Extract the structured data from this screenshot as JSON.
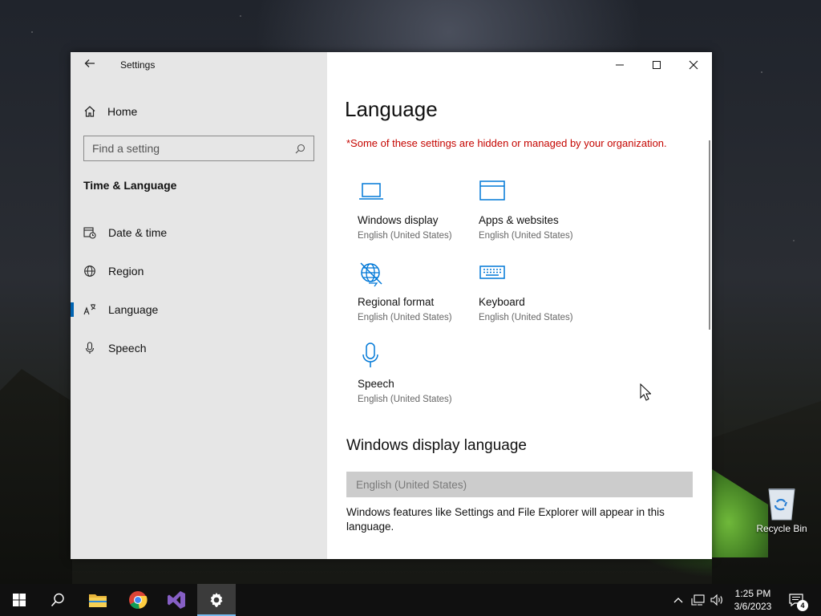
{
  "window": {
    "app_title": "Settings",
    "back_icon": "back-arrow-icon",
    "caption": {
      "minimize": "minimize-icon",
      "maximize": "maximize-icon",
      "close": "close-icon"
    }
  },
  "sidebar": {
    "home_label": "Home",
    "search_placeholder": "Find a setting",
    "section_title": "Time & Language",
    "items": [
      {
        "label": "Date & time",
        "icon": "calendar-clock-icon",
        "active": false
      },
      {
        "label": "Region",
        "icon": "globe-icon",
        "active": false
      },
      {
        "label": "Language",
        "icon": "language-icon",
        "active": true
      },
      {
        "label": "Speech",
        "icon": "microphone-icon",
        "active": false
      }
    ]
  },
  "main": {
    "title": "Language",
    "org_warning": "*Some of these settings are hidden or managed by your organization.",
    "tiles": [
      {
        "name": "Windows display",
        "sub": "English (United States)",
        "icon": "laptop-icon"
      },
      {
        "name": "Apps & websites",
        "sub": "English (United States)",
        "icon": "window-icon"
      },
      {
        "name": "Regional format",
        "sub": "English (United States)",
        "icon": "regional-globe-icon"
      },
      {
        "name": "Keyboard",
        "sub": "English (United States)",
        "icon": "keyboard-icon"
      },
      {
        "name": "Speech",
        "sub": "English (United States)",
        "icon": "microphone-icon"
      }
    ],
    "display_language_heading": "Windows display language",
    "display_language_value": "English (United States)",
    "display_language_desc": "Windows features like Settings and File Explorer will appear in this language."
  },
  "desktop": {
    "recycle_bin_label": "Recycle Bin"
  },
  "taskbar": {
    "apps": [
      "start-icon",
      "search-icon",
      "file-explorer-icon",
      "chrome-icon",
      "visual-studio-icon",
      "settings-gear-icon"
    ],
    "active_app": "settings-gear-icon",
    "time": "1:25 PM",
    "date": "3/6/2023",
    "notification_count": "4"
  },
  "colors": {
    "accent": "#0063b1",
    "icon_blue": "#0078d7",
    "warning_red": "#c50500",
    "sidebar_bg": "#e6e6e6"
  }
}
